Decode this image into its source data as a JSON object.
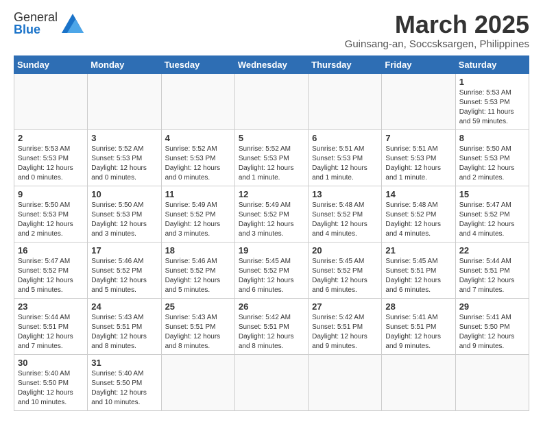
{
  "logo": {
    "text_general": "General",
    "text_blue": "Blue"
  },
  "title": "March 2025",
  "subtitle": "Guinsang-an, Soccsksargen, Philippines",
  "weekdays": [
    "Sunday",
    "Monday",
    "Tuesday",
    "Wednesday",
    "Thursday",
    "Friday",
    "Saturday"
  ],
  "weeks": [
    [
      null,
      null,
      null,
      null,
      null,
      null,
      {
        "day": "1",
        "sunrise": "5:53 AM",
        "sunset": "5:53 PM",
        "daylight": "11 hours and 59 minutes."
      }
    ],
    [
      {
        "day": "2",
        "sunrise": "5:53 AM",
        "sunset": "5:53 PM",
        "daylight": "12 hours and 0 minutes."
      },
      {
        "day": "3",
        "sunrise": "5:52 AM",
        "sunset": "5:53 PM",
        "daylight": "12 hours and 0 minutes."
      },
      {
        "day": "4",
        "sunrise": "5:52 AM",
        "sunset": "5:53 PM",
        "daylight": "12 hours and 0 minutes."
      },
      {
        "day": "5",
        "sunrise": "5:52 AM",
        "sunset": "5:53 PM",
        "daylight": "12 hours and 1 minute."
      },
      {
        "day": "6",
        "sunrise": "5:51 AM",
        "sunset": "5:53 PM",
        "daylight": "12 hours and 1 minute."
      },
      {
        "day": "7",
        "sunrise": "5:51 AM",
        "sunset": "5:53 PM",
        "daylight": "12 hours and 1 minute."
      },
      {
        "day": "8",
        "sunrise": "5:50 AM",
        "sunset": "5:53 PM",
        "daylight": "12 hours and 2 minutes."
      }
    ],
    [
      {
        "day": "9",
        "sunrise": "5:50 AM",
        "sunset": "5:53 PM",
        "daylight": "12 hours and 2 minutes."
      },
      {
        "day": "10",
        "sunrise": "5:50 AM",
        "sunset": "5:53 PM",
        "daylight": "12 hours and 3 minutes."
      },
      {
        "day": "11",
        "sunrise": "5:49 AM",
        "sunset": "5:52 PM",
        "daylight": "12 hours and 3 minutes."
      },
      {
        "day": "12",
        "sunrise": "5:49 AM",
        "sunset": "5:52 PM",
        "daylight": "12 hours and 3 minutes."
      },
      {
        "day": "13",
        "sunrise": "5:48 AM",
        "sunset": "5:52 PM",
        "daylight": "12 hours and 4 minutes."
      },
      {
        "day": "14",
        "sunrise": "5:48 AM",
        "sunset": "5:52 PM",
        "daylight": "12 hours and 4 minutes."
      },
      {
        "day": "15",
        "sunrise": "5:47 AM",
        "sunset": "5:52 PM",
        "daylight": "12 hours and 4 minutes."
      }
    ],
    [
      {
        "day": "16",
        "sunrise": "5:47 AM",
        "sunset": "5:52 PM",
        "daylight": "12 hours and 5 minutes."
      },
      {
        "day": "17",
        "sunrise": "5:46 AM",
        "sunset": "5:52 PM",
        "daylight": "12 hours and 5 minutes."
      },
      {
        "day": "18",
        "sunrise": "5:46 AM",
        "sunset": "5:52 PM",
        "daylight": "12 hours and 5 minutes."
      },
      {
        "day": "19",
        "sunrise": "5:45 AM",
        "sunset": "5:52 PM",
        "daylight": "12 hours and 6 minutes."
      },
      {
        "day": "20",
        "sunrise": "5:45 AM",
        "sunset": "5:52 PM",
        "daylight": "12 hours and 6 minutes."
      },
      {
        "day": "21",
        "sunrise": "5:45 AM",
        "sunset": "5:51 PM",
        "daylight": "12 hours and 6 minutes."
      },
      {
        "day": "22",
        "sunrise": "5:44 AM",
        "sunset": "5:51 PM",
        "daylight": "12 hours and 7 minutes."
      }
    ],
    [
      {
        "day": "23",
        "sunrise": "5:44 AM",
        "sunset": "5:51 PM",
        "daylight": "12 hours and 7 minutes."
      },
      {
        "day": "24",
        "sunrise": "5:43 AM",
        "sunset": "5:51 PM",
        "daylight": "12 hours and 8 minutes."
      },
      {
        "day": "25",
        "sunrise": "5:43 AM",
        "sunset": "5:51 PM",
        "daylight": "12 hours and 8 minutes."
      },
      {
        "day": "26",
        "sunrise": "5:42 AM",
        "sunset": "5:51 PM",
        "daylight": "12 hours and 8 minutes."
      },
      {
        "day": "27",
        "sunrise": "5:42 AM",
        "sunset": "5:51 PM",
        "daylight": "12 hours and 9 minutes."
      },
      {
        "day": "28",
        "sunrise": "5:41 AM",
        "sunset": "5:51 PM",
        "daylight": "12 hours and 9 minutes."
      },
      {
        "day": "29",
        "sunrise": "5:41 AM",
        "sunset": "5:50 PM",
        "daylight": "12 hours and 9 minutes."
      }
    ],
    [
      {
        "day": "30",
        "sunrise": "5:40 AM",
        "sunset": "5:50 PM",
        "daylight": "12 hours and 10 minutes."
      },
      {
        "day": "31",
        "sunrise": "5:40 AM",
        "sunset": "5:50 PM",
        "daylight": "12 hours and 10 minutes."
      },
      null,
      null,
      null,
      null,
      null
    ]
  ]
}
